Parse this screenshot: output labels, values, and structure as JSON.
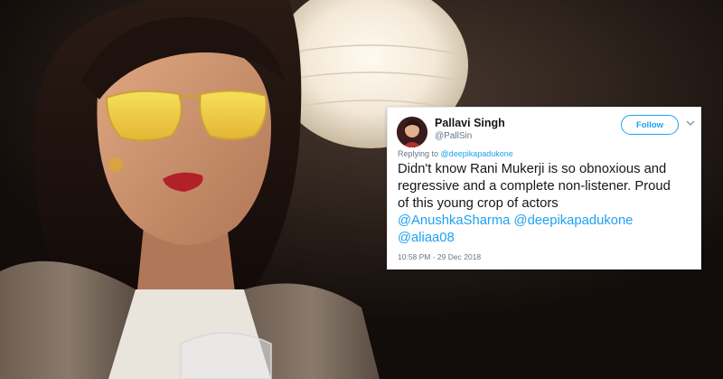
{
  "tweet": {
    "user_name": "Pallavi Singh",
    "user_handle": "@PallSin",
    "follow_label": "Follow",
    "reply_prefix": "Replying to",
    "reply_handle": "@deepikapadukone",
    "text_lines": [
      "Didn't know Rani Mukerji is so obnoxious and",
      "regressive and a complete non-listener. Proud",
      "of this young crop of actors"
    ],
    "mention_1": "@AnushkaSharma",
    "mention_2": "@deepikapadukone",
    "mention_3": "@aliaa08",
    "timestamp": "10:58 PM - 29 Dec 2018"
  },
  "colors": {
    "link": "#1da1f2",
    "text": "#14171a",
    "muted": "#657786"
  }
}
